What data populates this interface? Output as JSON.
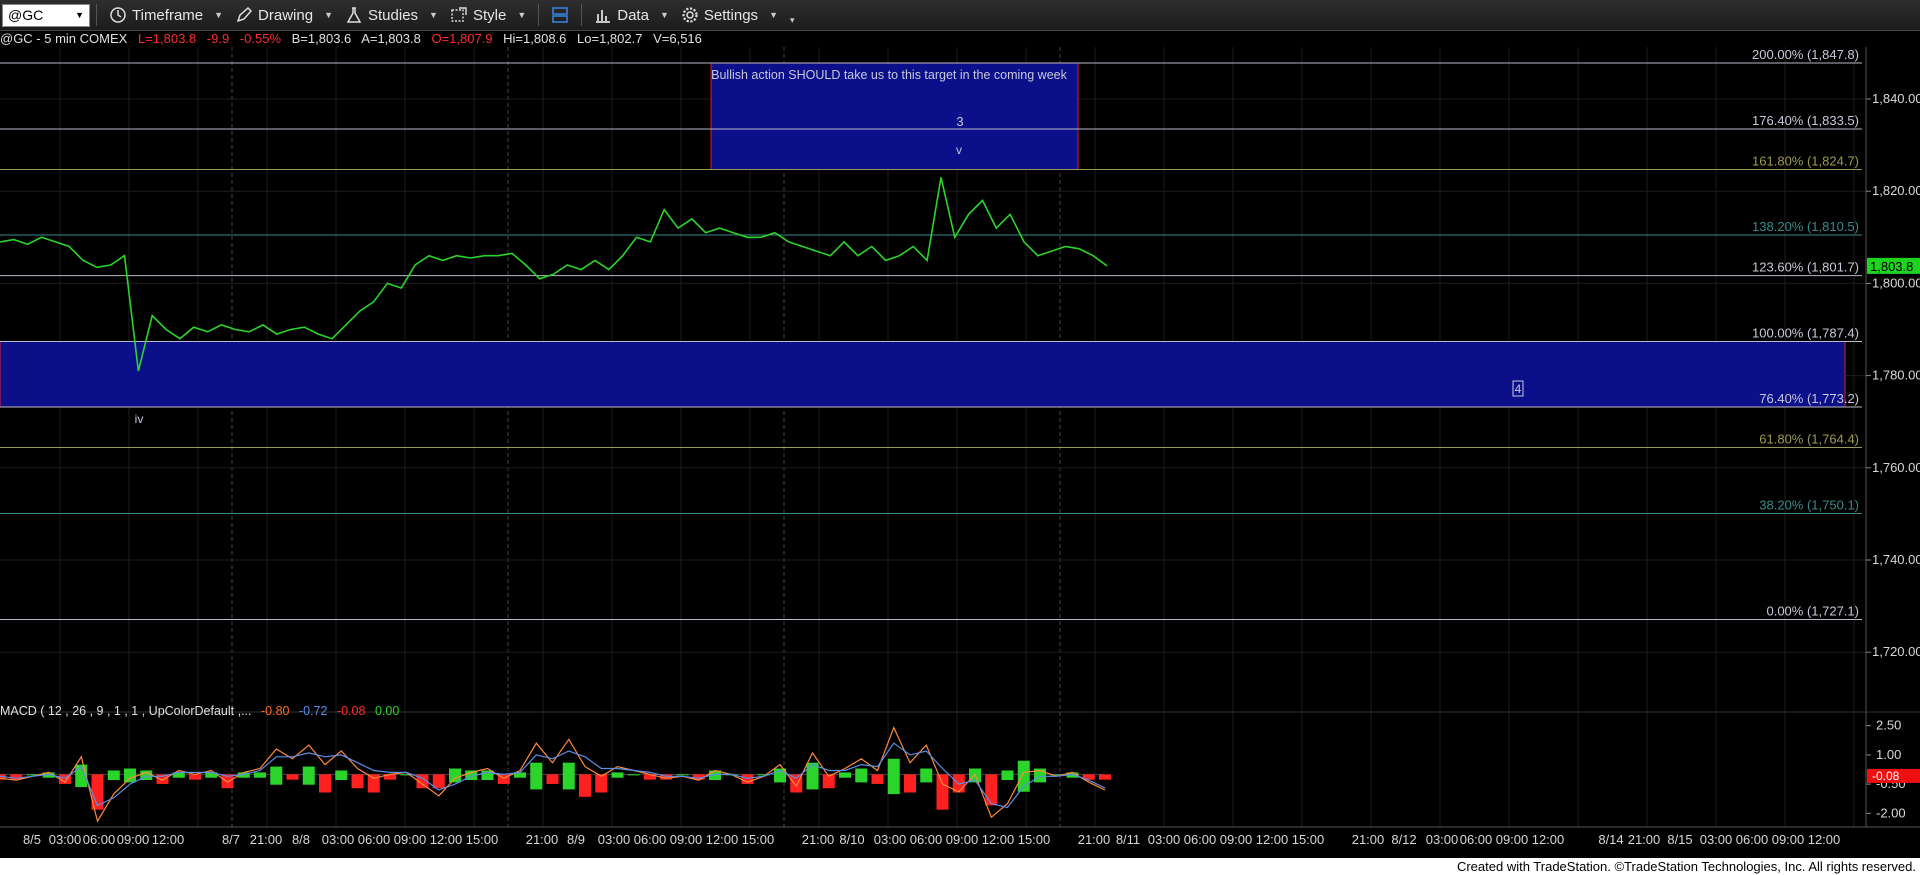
{
  "toolbar": {
    "symbol": "@GC",
    "timeframe": "Timeframe",
    "drawing": "Drawing",
    "studies": "Studies",
    "style": "Style",
    "data": "Data",
    "settings": "Settings"
  },
  "info": {
    "instrument": "@GC - 5 min  COMEX",
    "last": "L=1,803.8",
    "change": "-9.9",
    "change_pct": "-0.55%",
    "bid": "B=1,803.6",
    "ask": "A=1,803.8",
    "open": "O=1,807.9",
    "high": "Hi=1,808.6",
    "low": "Lo=1,802.7",
    "volume": "V=6,516"
  },
  "annotations": {
    "target_note": "Bullish action SHOULD take us to this target in the coming week",
    "wave_3": "3",
    "wave_v": "v",
    "wave_iv": "iv",
    "wave_4": "4"
  },
  "chart_data": {
    "type": "line",
    "price_axis": {
      "ticks": [
        "1,840.00",
        "1,820.00",
        "1,800.00",
        "1,780.00",
        "1,760.00",
        "1,740.00",
        "1,720.00"
      ],
      "tick_values": [
        1840,
        1820,
        1800,
        1780,
        1760,
        1740,
        1720
      ],
      "ylim": [
        1715,
        1850
      ],
      "last_price_label": "1,803.8",
      "last_price": 1803.8
    },
    "fib_levels": [
      {
        "label": "200.00% (1,847.8)",
        "value": 1847.8,
        "color": "#b9b9c8"
      },
      {
        "label": "176.40% (1,833.5)",
        "value": 1833.5,
        "color": "#b9b9c8"
      },
      {
        "label": "161.80% (1,824.7)",
        "value": 1824.7,
        "color": "#9a9a50"
      },
      {
        "label": "138.20% (1,810.5)",
        "value": 1810.5,
        "color": "#3a8a8a"
      },
      {
        "label": "123.60% (1,801.7)",
        "value": 1801.7,
        "color": "#b9b9c8"
      },
      {
        "label": "100.00% (1,787.4)",
        "value": 1787.4,
        "color": "#b9b9c8"
      },
      {
        "label": "76.40% (1,773.2)",
        "value": 1773.2,
        "color": "#b9b9c8"
      },
      {
        "label": "61.80% (1,764.4)",
        "value": 1764.4,
        "color": "#9a9a50"
      },
      {
        "label": "38.20% (1,750.1)",
        "value": 1750.1,
        "color": "#3a8a8a"
      },
      {
        "label": "0.00% (1,727.1)",
        "value": 1727.1,
        "color": "#b9b9c8"
      }
    ],
    "target_zone": {
      "from": 1824.7,
      "to": 1847.8
    },
    "support_zone": {
      "from": 1773.2,
      "to": 1787.4
    },
    "x_labels": [
      "8/5",
      "03:00",
      "06:00",
      "09:00",
      "12:00",
      "8/7",
      "21:00",
      "8/8",
      "03:00",
      "06:00",
      "09:00",
      "12:00",
      "15:00",
      "21:00",
      "8/9",
      "03:00",
      "06:00",
      "09:00",
      "12:00",
      "15:00",
      "21:00",
      "8/10",
      "03:00",
      "06:00",
      "09:00",
      "12:00",
      "15:00",
      "21:00",
      "8/11",
      "03:00",
      "06:00",
      "09:00",
      "12:00",
      "15:00",
      "21:00",
      "8/12",
      "03:00",
      "06:00",
      "09:00",
      "12:00",
      "8/14",
      "21:00",
      "8/15",
      "03:00",
      "06:00",
      "09:00",
      "12:00"
    ],
    "price_series": [
      1809,
      1809.5,
      1808.5,
      1810,
      1809,
      1808,
      1805,
      1803.5,
      1804,
      1806,
      1781,
      1793,
      1790,
      1788,
      1790.5,
      1789.5,
      1791,
      1790,
      1789.5,
      1791,
      1789,
      1790,
      1790.5,
      1789,
      1788,
      1791,
      1794,
      1796,
      1800,
      1799,
      1804,
      1806,
      1805,
      1806,
      1805.5,
      1806,
      1806,
      1806.5,
      1804,
      1801,
      1802,
      1804,
      1803,
      1805,
      1803,
      1806,
      1810,
      1809,
      1816,
      1812,
      1814,
      1811,
      1812,
      1811,
      1810,
      1810,
      1811,
      1809,
      1808,
      1807,
      1806,
      1809,
      1806,
      1808,
      1805,
      1806,
      1808,
      1805,
      1823,
      1810,
      1815,
      1818,
      1812,
      1815,
      1809,
      1806,
      1807,
      1808,
      1807.5,
      1806,
      1803.8
    ],
    "macd": {
      "label": "MACD ( 12 , 26 , 9 , 1 , 1 , UpColorDefault ,...",
      "values": [
        "-0.80",
        "-0.72",
        "-0.08",
        "0.00"
      ],
      "axis_ticks": [
        "2.50",
        "1.00",
        "-0.50",
        "-2.00"
      ],
      "axis_values": [
        2.5,
        1.0,
        -0.5,
        -2.0
      ],
      "current_label": "-0.08",
      "ylim": [
        -2.7,
        3.2
      ],
      "macd_series": [
        -0.2,
        -0.3,
        -0.1,
        0.1,
        -0.4,
        0.9,
        -2.4,
        -1.0,
        -0.2,
        0.1,
        -0.3,
        0.2,
        0.0,
        0.2,
        -0.4,
        0.1,
        0.3,
        1.3,
        0.8,
        1.5,
        0.5,
        1.2,
        0.3,
        -0.2,
        0.0,
        0.1,
        -0.5,
        -1.1,
        -0.2,
        0.1,
        0.3,
        -0.2,
        0.2,
        1.6,
        0.6,
        1.8,
        0.4,
        -0.1,
        0.4,
        0.2,
        0.0,
        -0.2,
        -0.1,
        -0.3,
        0.2,
        0.0,
        -0.4,
        -0.1,
        0.5,
        -0.6,
        1.1,
        -0.1,
        0.3,
        0.8,
        0.2,
        2.4,
        0.6,
        1.5,
        -0.5,
        -0.9,
        0.0,
        -2.2,
        -1.5,
        0.1,
        0.2,
        -0.1,
        0.1,
        -0.4,
        -0.8
      ],
      "signal_series": [
        -0.1,
        -0.2,
        -0.1,
        0.0,
        -0.2,
        0.4,
        -1.6,
        -1.2,
        -0.5,
        -0.1,
        -0.1,
        0.1,
        0.1,
        0.1,
        -0.1,
        0.0,
        0.2,
        0.9,
        0.9,
        1.1,
        0.9,
        1.0,
        0.6,
        0.2,
        0.1,
        0.1,
        -0.2,
        -0.8,
        -0.5,
        -0.1,
        0.1,
        0.0,
        0.1,
        1.0,
        0.8,
        1.2,
        0.9,
        0.3,
        0.3,
        0.2,
        0.1,
        -0.1,
        -0.1,
        -0.2,
        0.0,
        0.0,
        -0.2,
        -0.1,
        0.2,
        -0.2,
        0.5,
        0.2,
        0.2,
        0.5,
        0.4,
        1.6,
        1.0,
        1.2,
        0.3,
        -0.5,
        -0.3,
        -1.5,
        -1.7,
        -0.6,
        -0.1,
        -0.1,
        0.0,
        -0.3,
        -0.7
      ],
      "hist_series": [
        -0.1,
        -0.1,
        0.0,
        0.1,
        -0.2,
        0.5,
        -0.8,
        0.2,
        0.3,
        0.2,
        -0.2,
        0.1,
        -0.1,
        0.1,
        -0.3,
        0.1,
        0.1,
        0.4,
        -0.1,
        0.4,
        -0.4,
        0.2,
        -0.3,
        -0.4,
        -0.1,
        0.0,
        -0.3,
        -0.3,
        0.3,
        0.2,
        0.2,
        -0.2,
        0.1,
        0.6,
        -0.2,
        0.6,
        -0.5,
        -0.4,
        0.1,
        0.0,
        -0.1,
        -0.1,
        0.0,
        -0.1,
        0.2,
        0.0,
        -0.2,
        0.0,
        0.3,
        -0.4,
        0.6,
        -0.3,
        0.1,
        0.3,
        -0.2,
        0.8,
        -0.4,
        0.3,
        -0.8,
        -0.4,
        0.3,
        -0.7,
        0.2,
        0.7,
        0.3,
        0.0,
        0.1,
        -0.1,
        -0.1
      ]
    }
  },
  "footer": {
    "text": "Created with TradeStation. ©TradeStation Technologies, Inc. All rights reserved."
  }
}
